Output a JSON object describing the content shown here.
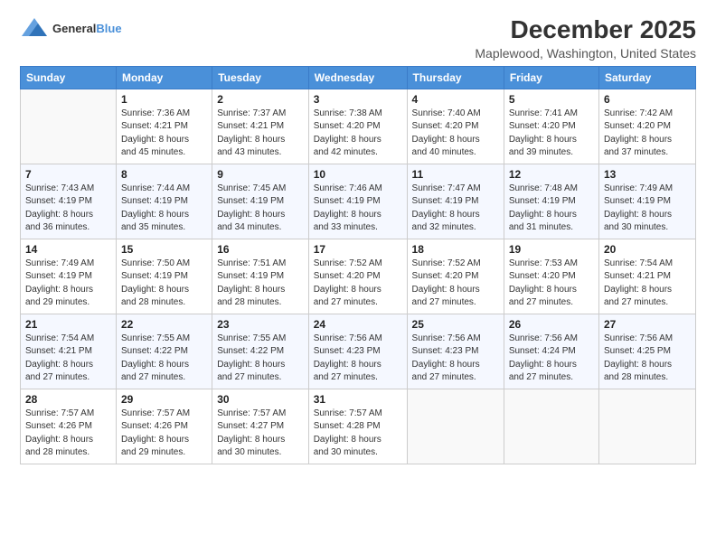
{
  "header": {
    "logo_general": "General",
    "logo_blue": "Blue",
    "title": "December 2025",
    "subtitle": "Maplewood, Washington, United States"
  },
  "days_of_week": [
    "Sunday",
    "Monday",
    "Tuesday",
    "Wednesday",
    "Thursday",
    "Friday",
    "Saturday"
  ],
  "weeks": [
    [
      {
        "day": "",
        "info": ""
      },
      {
        "day": "1",
        "info": "Sunrise: 7:36 AM\nSunset: 4:21 PM\nDaylight: 8 hours\nand 45 minutes."
      },
      {
        "day": "2",
        "info": "Sunrise: 7:37 AM\nSunset: 4:21 PM\nDaylight: 8 hours\nand 43 minutes."
      },
      {
        "day": "3",
        "info": "Sunrise: 7:38 AM\nSunset: 4:20 PM\nDaylight: 8 hours\nand 42 minutes."
      },
      {
        "day": "4",
        "info": "Sunrise: 7:40 AM\nSunset: 4:20 PM\nDaylight: 8 hours\nand 40 minutes."
      },
      {
        "day": "5",
        "info": "Sunrise: 7:41 AM\nSunset: 4:20 PM\nDaylight: 8 hours\nand 39 minutes."
      },
      {
        "day": "6",
        "info": "Sunrise: 7:42 AM\nSunset: 4:20 PM\nDaylight: 8 hours\nand 37 minutes."
      }
    ],
    [
      {
        "day": "7",
        "info": "Sunrise: 7:43 AM\nSunset: 4:19 PM\nDaylight: 8 hours\nand 36 minutes."
      },
      {
        "day": "8",
        "info": "Sunrise: 7:44 AM\nSunset: 4:19 PM\nDaylight: 8 hours\nand 35 minutes."
      },
      {
        "day": "9",
        "info": "Sunrise: 7:45 AM\nSunset: 4:19 PM\nDaylight: 8 hours\nand 34 minutes."
      },
      {
        "day": "10",
        "info": "Sunrise: 7:46 AM\nSunset: 4:19 PM\nDaylight: 8 hours\nand 33 minutes."
      },
      {
        "day": "11",
        "info": "Sunrise: 7:47 AM\nSunset: 4:19 PM\nDaylight: 8 hours\nand 32 minutes."
      },
      {
        "day": "12",
        "info": "Sunrise: 7:48 AM\nSunset: 4:19 PM\nDaylight: 8 hours\nand 31 minutes."
      },
      {
        "day": "13",
        "info": "Sunrise: 7:49 AM\nSunset: 4:19 PM\nDaylight: 8 hours\nand 30 minutes."
      }
    ],
    [
      {
        "day": "14",
        "info": "Sunrise: 7:49 AM\nSunset: 4:19 PM\nDaylight: 8 hours\nand 29 minutes."
      },
      {
        "day": "15",
        "info": "Sunrise: 7:50 AM\nSunset: 4:19 PM\nDaylight: 8 hours\nand 28 minutes."
      },
      {
        "day": "16",
        "info": "Sunrise: 7:51 AM\nSunset: 4:19 PM\nDaylight: 8 hours\nand 28 minutes."
      },
      {
        "day": "17",
        "info": "Sunrise: 7:52 AM\nSunset: 4:20 PM\nDaylight: 8 hours\nand 27 minutes."
      },
      {
        "day": "18",
        "info": "Sunrise: 7:52 AM\nSunset: 4:20 PM\nDaylight: 8 hours\nand 27 minutes."
      },
      {
        "day": "19",
        "info": "Sunrise: 7:53 AM\nSunset: 4:20 PM\nDaylight: 8 hours\nand 27 minutes."
      },
      {
        "day": "20",
        "info": "Sunrise: 7:54 AM\nSunset: 4:21 PM\nDaylight: 8 hours\nand 27 minutes."
      }
    ],
    [
      {
        "day": "21",
        "info": "Sunrise: 7:54 AM\nSunset: 4:21 PM\nDaylight: 8 hours\nand 27 minutes."
      },
      {
        "day": "22",
        "info": "Sunrise: 7:55 AM\nSunset: 4:22 PM\nDaylight: 8 hours\nand 27 minutes."
      },
      {
        "day": "23",
        "info": "Sunrise: 7:55 AM\nSunset: 4:22 PM\nDaylight: 8 hours\nand 27 minutes."
      },
      {
        "day": "24",
        "info": "Sunrise: 7:56 AM\nSunset: 4:23 PM\nDaylight: 8 hours\nand 27 minutes."
      },
      {
        "day": "25",
        "info": "Sunrise: 7:56 AM\nSunset: 4:23 PM\nDaylight: 8 hours\nand 27 minutes."
      },
      {
        "day": "26",
        "info": "Sunrise: 7:56 AM\nSunset: 4:24 PM\nDaylight: 8 hours\nand 27 minutes."
      },
      {
        "day": "27",
        "info": "Sunrise: 7:56 AM\nSunset: 4:25 PM\nDaylight: 8 hours\nand 28 minutes."
      }
    ],
    [
      {
        "day": "28",
        "info": "Sunrise: 7:57 AM\nSunset: 4:26 PM\nDaylight: 8 hours\nand 28 minutes."
      },
      {
        "day": "29",
        "info": "Sunrise: 7:57 AM\nSunset: 4:26 PM\nDaylight: 8 hours\nand 29 minutes."
      },
      {
        "day": "30",
        "info": "Sunrise: 7:57 AM\nSunset: 4:27 PM\nDaylight: 8 hours\nand 30 minutes."
      },
      {
        "day": "31",
        "info": "Sunrise: 7:57 AM\nSunset: 4:28 PM\nDaylight: 8 hours\nand 30 minutes."
      },
      {
        "day": "",
        "info": ""
      },
      {
        "day": "",
        "info": ""
      },
      {
        "day": "",
        "info": ""
      }
    ]
  ]
}
